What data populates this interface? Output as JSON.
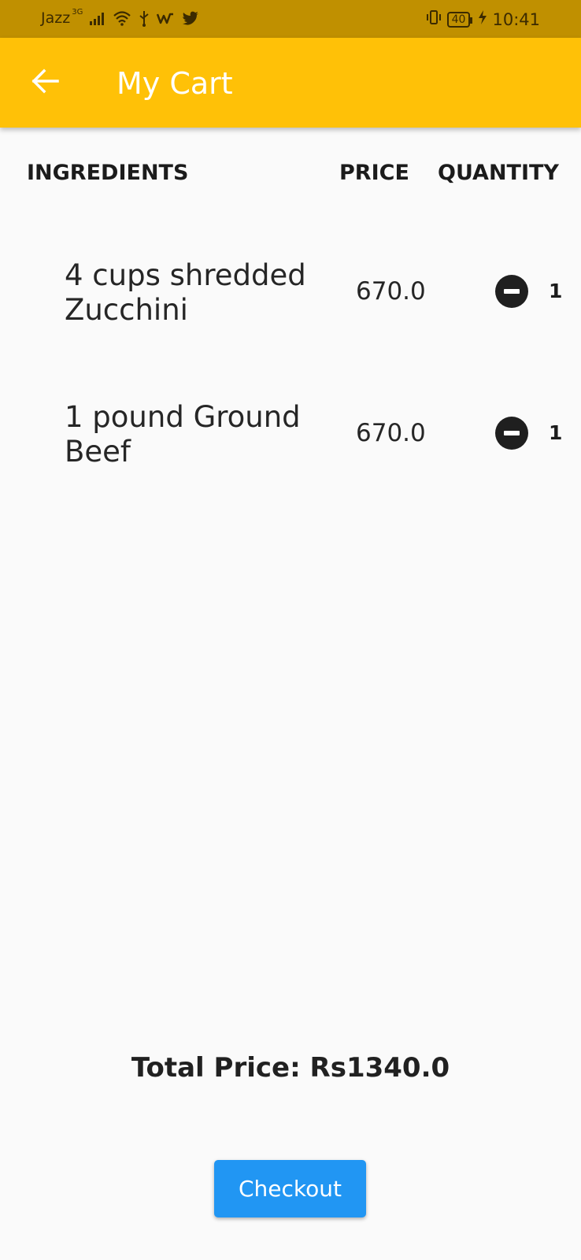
{
  "status_bar": {
    "carrier": "Jazz",
    "network": "3G",
    "battery": "40",
    "time": "10:41"
  },
  "app_bar": {
    "title": "My Cart",
    "back_icon": "arrow-left-icon"
  },
  "table": {
    "headers": {
      "ingredients": "INGREDIENTS",
      "price": "PRICE",
      "quantity": "QUANTITY"
    },
    "items": [
      {
        "name": "4 cups shredded Zucchini",
        "price": "670.0",
        "quantity": "1"
      },
      {
        "name": "1 pound Ground Beef",
        "price": "670.0",
        "quantity": "1"
      }
    ]
  },
  "summary": {
    "total_label": "Total Price: Rs1340.0"
  },
  "actions": {
    "checkout_label": "Checkout"
  },
  "colors": {
    "app_bar": "#ffc107",
    "status_bar": "#c09000",
    "checkout": "#2196f3",
    "background": "#fafafa"
  }
}
